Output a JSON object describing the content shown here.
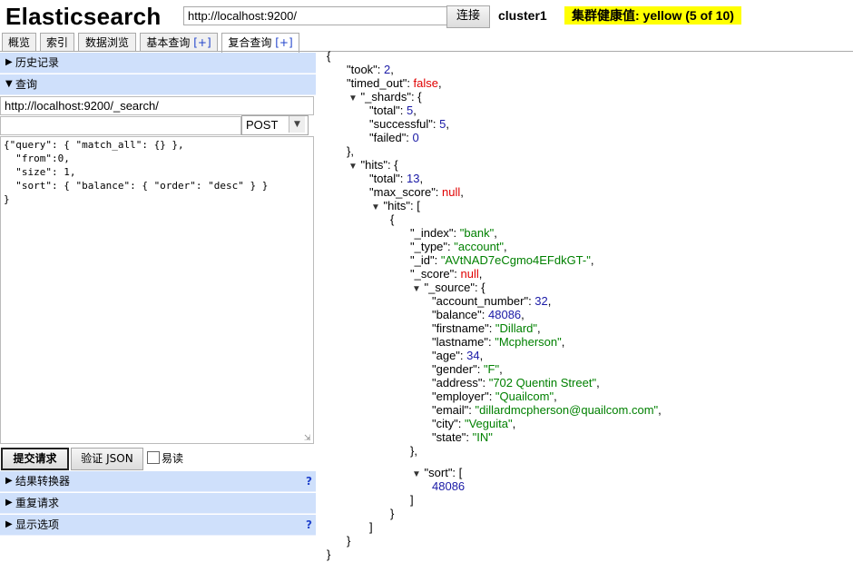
{
  "header": {
    "logo": "Elasticsearch",
    "url": "http://localhost:9200/",
    "connect_label": "连接",
    "cluster_name": "cluster1",
    "health": "集群健康值: yellow (5 of 10)"
  },
  "tabs": [
    {
      "label": "概览",
      "suffix": ""
    },
    {
      "label": "索引",
      "suffix": ""
    },
    {
      "label": "数据浏览",
      "suffix": ""
    },
    {
      "label": "基本查询",
      "suffix": "[+]"
    },
    {
      "label": "复合查询",
      "suffix": "[+]"
    }
  ],
  "left": {
    "history_label": "历史记录",
    "query_label": "查询",
    "request_url": "http://localhost:9200/_search/",
    "path_value": "",
    "method": "POST",
    "query_lines": [
      "{\"query\": { \"match_all\": {} },",
      "  \"from\":0,",
      "  \"size\": 1,",
      "  \"sort\": { \"balance\": { \"order\": \"desc\" } }",
      "}"
    ],
    "submit_label": "提交请求",
    "validate_label": "验证 JSON",
    "readable_label": "易读",
    "result_transformer_label": "结果转换器",
    "repeat_request_label": "重复请求",
    "display_options_label": "显示选项",
    "help_mark": "?"
  },
  "response": {
    "took": "2",
    "timed_out": "false",
    "shards_total": "5",
    "shards_successful": "5",
    "shards_failed": "0",
    "hits_total": "13",
    "max_score": "null",
    "index": "\"bank\"",
    "type": "\"account\"",
    "id": "\"AVtNAD7eCgmo4EFdkGT-\"",
    "score": "null",
    "account_number": "32",
    "balance": "48086",
    "firstname": "\"Dillard\"",
    "lastname": "\"Mcpherson\"",
    "age": "34",
    "gender": "\"F\"",
    "address": "\"702 Quentin Street\"",
    "employer": "\"Quailcom\"",
    "email": "\"dillardmcpherson@quailcom.com\"",
    "city": "\"Veguita\"",
    "state": "\"IN\"",
    "sort_value": "48086"
  },
  "colors": {
    "health_bg": "#ffff00",
    "bar_bg": "#cfe0fb",
    "json_number": "#1a1aa6",
    "json_string": "#008000",
    "json_literal": "#e00000"
  }
}
